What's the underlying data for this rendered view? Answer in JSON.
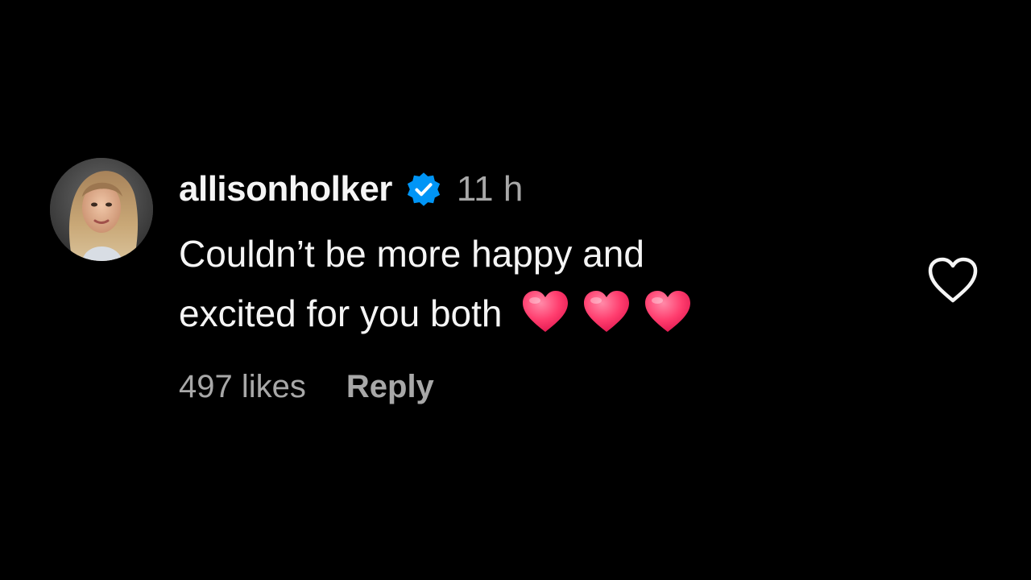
{
  "comment": {
    "username": "allisonholker",
    "verified_icon": "verified-badge-icon",
    "timestamp": "11 h",
    "text_line_1": "Couldn’t be more happy and",
    "text_line_2": "excited for you both",
    "emojis": [
      "red-heart-emoji",
      "red-heart-emoji",
      "red-heart-emoji"
    ],
    "likes": "497 likes",
    "reply_label": "Reply",
    "like_icon": "heart-outline-icon"
  },
  "colors": {
    "background": "#000000",
    "primary_text": "#f5f5f5",
    "secondary_text": "#a8a8a8",
    "verified_blue": "#0095f6",
    "heart_pink": "#ff3d6e"
  }
}
